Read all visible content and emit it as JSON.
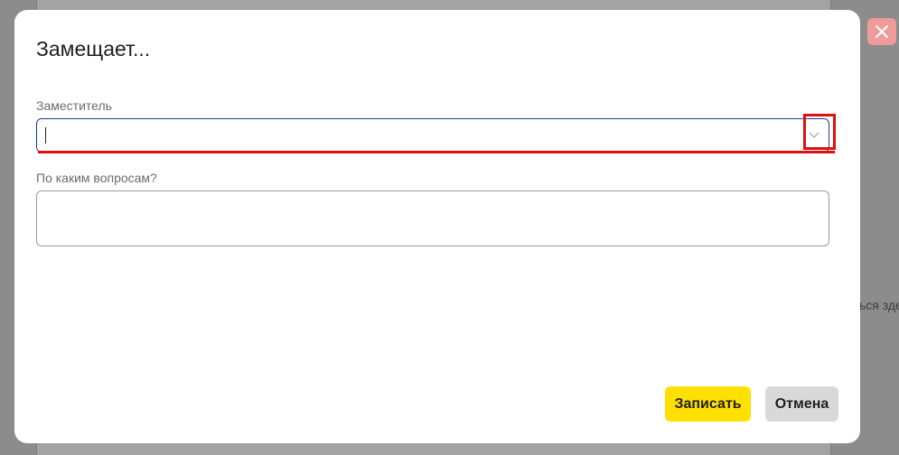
{
  "modal": {
    "title": "Замещает...",
    "substitute_label": "Заместитель",
    "substitute_value": "",
    "questions_label": "По каким вопросам?",
    "questions_value": "",
    "save_label": "Записать",
    "cancel_label": "Отмена"
  },
  "background": {
    "partial_text": "ься зде"
  },
  "icons": {
    "close": "close-icon",
    "dropdown": "chevron-down-icon"
  },
  "colors": {
    "save_button": "#ffe000",
    "cancel_button": "#d9d9d9",
    "close_button": "#f19a9a",
    "focus_border": "#1a3f8c",
    "highlight": "#e01010"
  }
}
